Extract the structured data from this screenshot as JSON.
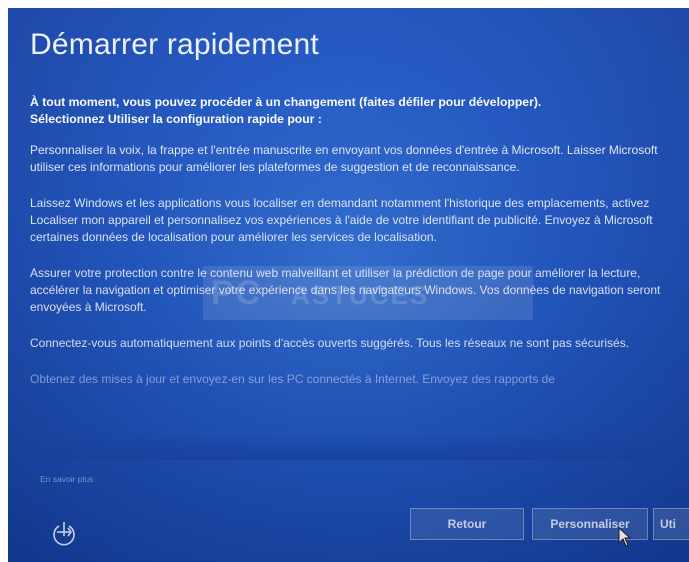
{
  "title": "Démarrer rapidement",
  "intro": {
    "line1": "À tout moment, vous pouvez procéder à un changement (faites défiler pour développer).",
    "line2": "Sélectionnez Utiliser la configuration rapide pour :"
  },
  "paragraphs": [
    "Personnaliser la voix, la frappe et l'entrée manuscrite en envoyant vos données d'entrée à Microsoft. Laisser Microsoft utiliser ces informations pour améliorer les plateformes de suggestion et de reconnaissance.",
    "Laissez Windows et les applications vous localiser en demandant notamment l'historique des emplacements, activez Localiser mon appareil et personnalisez vos expériences à l'aide de votre identifiant de publicité. Envoyez à Microsoft certaines données de localisation pour améliorer les services de localisation.",
    "Assurer votre protection contre le contenu web malveillant et utiliser la prédiction de page pour améliorer la lecture, accélérer la navigation et optimiser votre expérience dans les navigateurs Windows. Vos données de navigation seront envoyées à Microsoft.",
    "Connectez-vous automatiquement aux points d'accès ouverts suggérés. Tous les réseaux ne sont pas sécurisés.",
    "Obtenez des mises à jour et envoyez-en sur les PC connectés à Internet. Envoyez des rapports de"
  ],
  "watermark": {
    "left": "PC",
    "right": "ASTUCES"
  },
  "learn_more": "En savoir plus",
  "buttons": {
    "back": "Retour",
    "customize": "Personnaliser",
    "express": "Uti"
  },
  "icons": {
    "accessibility": "ease-of-access-icon",
    "cursor": "mouse-pointer-icon"
  },
  "colors": {
    "background": "#1f56c4",
    "text": "#ffffff"
  }
}
